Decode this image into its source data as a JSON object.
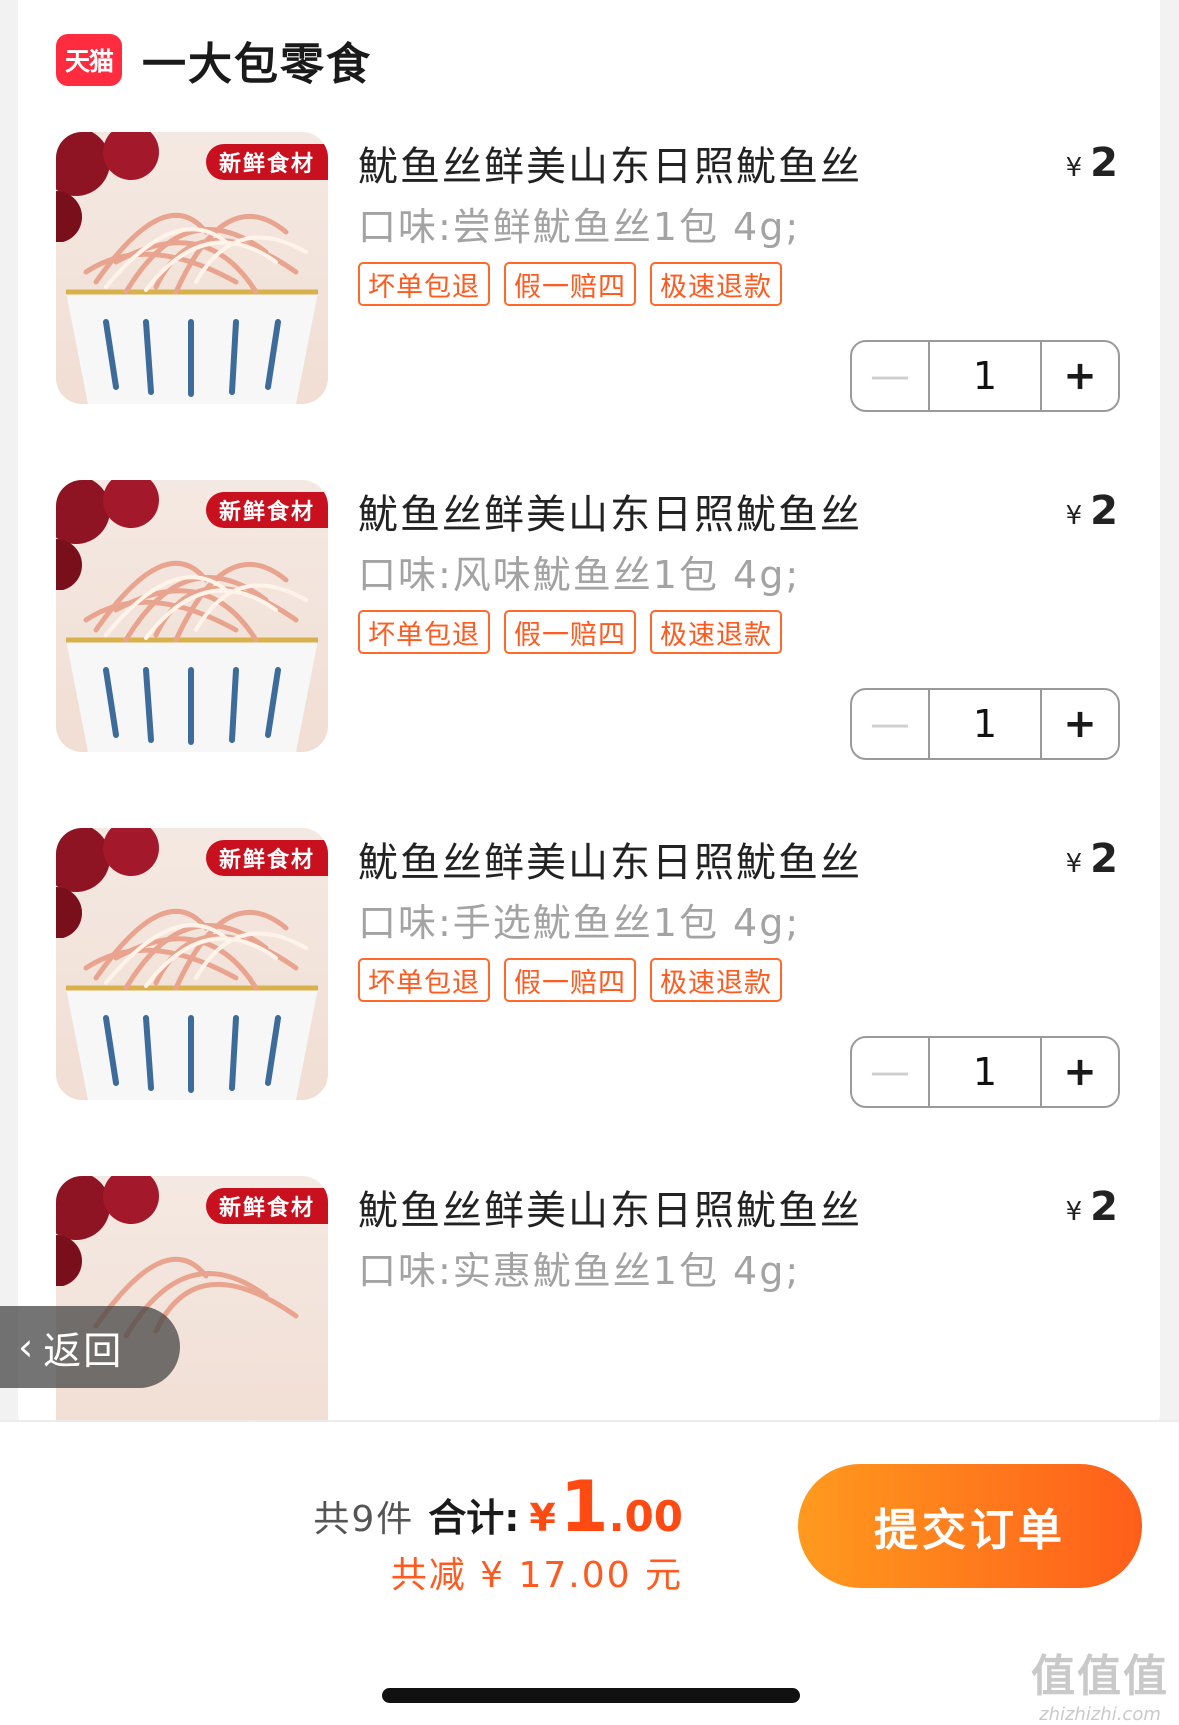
{
  "store": {
    "logo_text": "天猫",
    "name": "一大包零食"
  },
  "items": [
    {
      "title": "魷鱼丝鲜美山东日照魷鱼丝",
      "spec": "口味:尝鲜魷鱼丝1包 4g;",
      "tags": [
        "坏单包退",
        "假一赔四",
        "极速退款"
      ],
      "currency": "¥",
      "price": "2",
      "quantity": "1",
      "badge": "新鲜食材"
    },
    {
      "title": "魷鱼丝鲜美山东日照魷鱼丝",
      "spec": "口味:风味魷鱼丝1包 4g;",
      "tags": [
        "坏单包退",
        "假一赔四",
        "极速退款"
      ],
      "currency": "¥",
      "price": "2",
      "quantity": "1",
      "badge": "新鲜食材"
    },
    {
      "title": "魷鱼丝鲜美山东日照魷鱼丝",
      "spec": "口味:手选魷鱼丝1包 4g;",
      "tags": [
        "坏单包退",
        "假一赔四",
        "极速退款"
      ],
      "currency": "¥",
      "price": "2",
      "quantity": "1",
      "badge": "新鲜食材"
    },
    {
      "title": "魷鱼丝鲜美山东日照魷鱼丝",
      "spec": "口味:实惠魷鱼丝1包 4g;",
      "currency": "¥",
      "price": "2",
      "badge": "新鲜食材"
    }
  ],
  "back": {
    "label": "返回"
  },
  "summary": {
    "count_text": "共9件",
    "total_label": "合计:",
    "currency": "¥",
    "total_int": "1",
    "total_dec": ".00",
    "discount_text": "共减 ¥ 17.00 元"
  },
  "submit": {
    "label": "提交订单"
  },
  "watermark": {
    "big": "值值值",
    "small": "zhizhizhi.com"
  },
  "colors": {
    "accent": "#ff5a1f",
    "tmall_red": "#ff2b3f",
    "button_start": "#ff9a1e",
    "button_end": "#ff5e1a"
  },
  "icons": {
    "back": "chevron-left-icon",
    "minus": "minus-icon",
    "plus": "plus-icon"
  }
}
